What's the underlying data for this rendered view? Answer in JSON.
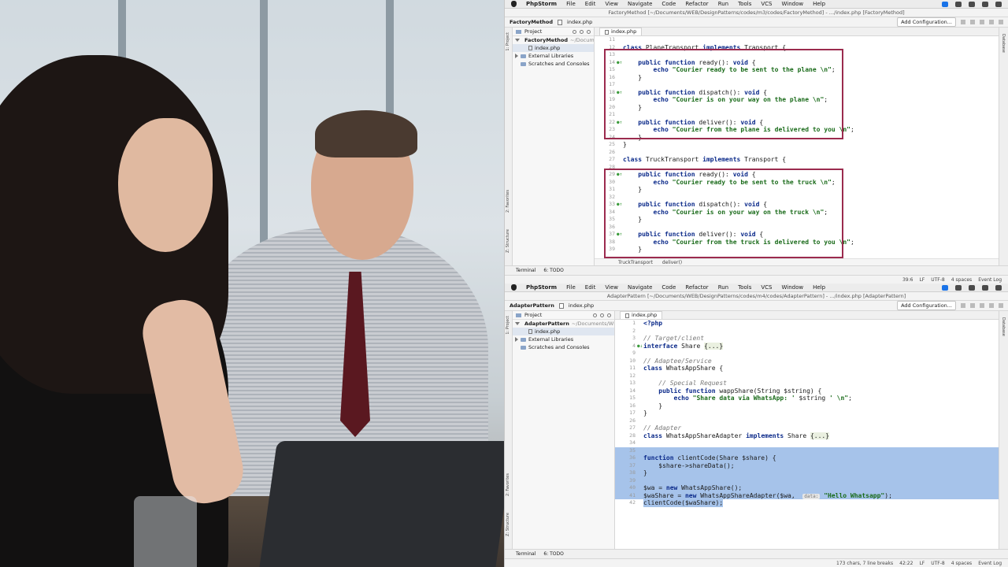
{
  "top": {
    "menubar": {
      "app": "PhpStorm",
      "items": [
        "File",
        "Edit",
        "View",
        "Navigate",
        "Code",
        "Refactor",
        "Run",
        "Tools",
        "VCS",
        "Window",
        "Help"
      ]
    },
    "title": "FactoryMethod [~/Documents/WEB/DesignPatterns/codes/m3/codes/FactoryMethod] - .../index.php [FactoryMethod]",
    "nav": {
      "project": "FactoryMethod",
      "file": "index.php",
      "add_config": "Add Configuration..."
    },
    "project_pane": {
      "label": "Project",
      "items": [
        {
          "label": "FactoryMethod",
          "path": "~/Documents"
        },
        {
          "label": "index.php"
        },
        {
          "label": "External Libraries"
        },
        {
          "label": "Scratches and Consoles"
        }
      ]
    },
    "tab": "index.php",
    "left_tabs": [
      "1: Project",
      "2: Favorites",
      "Z: Structure"
    ],
    "right_tab": "Database",
    "code": [
      {
        "n": "11",
        "html": ""
      },
      {
        "n": "12",
        "html": "<span class='kw'>class</span> PlaneTransport <span class='kw'>implements</span> Transport {"
      },
      {
        "n": "13",
        "html": ""
      },
      {
        "n": "14",
        "html": "    <span class='kw'>public function</span> ready(): <span class='kw'>void</span> {"
      },
      {
        "n": "15",
        "html": "        <span class='kw'>echo</span> <span class='str'>\"Courier ready to be sent to the plane \\n\"</span>;"
      },
      {
        "n": "16",
        "html": "    }"
      },
      {
        "n": "17",
        "html": ""
      },
      {
        "n": "18",
        "html": "    <span class='kw'>public function</span> dispatch(): <span class='kw'>void</span> {"
      },
      {
        "n": "19",
        "html": "        <span class='kw'>echo</span> <span class='str'>\"Courier is on your way on the plane \\n\"</span>;"
      },
      {
        "n": "20",
        "html": "    }"
      },
      {
        "n": "21",
        "html": ""
      },
      {
        "n": "22",
        "html": "    <span class='kw'>public function</span> deliver(): <span class='kw'>void</span> {"
      },
      {
        "n": "23",
        "html": "        <span class='kw'>echo</span> <span class='str'>\"Courier from the plane is delivered to you \\n\"</span>;"
      },
      {
        "n": "24",
        "html": "    }"
      },
      {
        "n": "25",
        "html": "}"
      },
      {
        "n": "26",
        "html": ""
      },
      {
        "n": "27",
        "html": "<span class='kw'>class</span> TruckTransport <span class='kw'>implements</span> Transport {"
      },
      {
        "n": "28",
        "html": ""
      },
      {
        "n": "29",
        "html": "    <span class='kw'>public function</span> ready(): <span class='kw'>void</span> {"
      },
      {
        "n": "30",
        "html": "        <span class='kw'>echo</span> <span class='str'>\"Courier ready to be sent to the truck \\n\"</span>;"
      },
      {
        "n": "31",
        "html": "    }"
      },
      {
        "n": "32",
        "html": ""
      },
      {
        "n": "33",
        "html": "    <span class='kw'>public function</span> dispatch(): <span class='kw'>void</span> {"
      },
      {
        "n": "34",
        "html": "        <span class='kw'>echo</span> <span class='str'>\"Courier is on your way on the truck \\n\"</span>;"
      },
      {
        "n": "35",
        "html": "    }"
      },
      {
        "n": "36",
        "html": ""
      },
      {
        "n": "37",
        "html": "    <span class='kw'>public function</span> deliver(): <span class='kw'>void</span> {"
      },
      {
        "n": "38",
        "html": "        <span class='kw'>echo</span> <span class='str'>\"Courier from the truck is delivered to you \\n\"</span>;"
      },
      {
        "n": "39",
        "html": "    }"
      }
    ],
    "markers": {
      "14": "●↑",
      "18": "●↑",
      "22": "●↑",
      "29": "●↑",
      "33": "●↑",
      "37": "●↑"
    },
    "breadcrumb": [
      "TruckTransport",
      "deliver()"
    ],
    "bottom_tools": [
      "Terminal",
      "6: TODO"
    ],
    "status": {
      "pos": "39:6",
      "lf": "LF",
      "enc": "UTF-8",
      "indent": "4 spaces",
      "event_log": "Event Log"
    }
  },
  "bottom": {
    "menubar": {
      "app": "PhpStorm",
      "items": [
        "File",
        "Edit",
        "View",
        "Navigate",
        "Code",
        "Refactor",
        "Run",
        "Tools",
        "VCS",
        "Window",
        "Help"
      ]
    },
    "title": "AdapterPattern [~/Documents/WEB/DesignPatterns/codes/m4/codes/AdapterPattern] - .../index.php [AdapterPattern]",
    "nav": {
      "project": "AdapterPattern",
      "file": "index.php",
      "add_config": "Add Configuration..."
    },
    "project_pane": {
      "label": "Project",
      "items": [
        {
          "label": "AdapterPattern",
          "path": "~/Documents/WE"
        },
        {
          "label": "index.php"
        },
        {
          "label": "External Libraries"
        },
        {
          "label": "Scratches and Consoles"
        }
      ]
    },
    "tab": "index.php",
    "left_tabs": [
      "1: Project",
      "2: Favorites",
      "Z: Structure"
    ],
    "right_tab": "Database",
    "code": [
      {
        "n": "1",
        "html": "<span class='kw'>&lt;?php</span>"
      },
      {
        "n": "2",
        "html": ""
      },
      {
        "n": "3",
        "html": "<span class='cm'>// Target/client</span>"
      },
      {
        "n": "4",
        "html": "<span class='kw'>interface</span> Share <span class='fold'>{...}</span>"
      },
      {
        "n": "9",
        "html": ""
      },
      {
        "n": "10",
        "html": "<span class='cm'>// Adaptee/Service</span>"
      },
      {
        "n": "11",
        "html": "<span class='kw'>class</span> WhatsAppShare {"
      },
      {
        "n": "12",
        "html": ""
      },
      {
        "n": "13",
        "html": "    <span class='cm'>// Special Request</span>"
      },
      {
        "n": "14",
        "html": "    <span class='kw'>public function</span> wappShare(String $string) {"
      },
      {
        "n": "15",
        "html": "        <span class='kw'>echo</span> <span class='str'>\"Share data via WhatsApp: '</span> $string <span class='str'>' \\n\"</span>;"
      },
      {
        "n": "16",
        "html": "    }"
      },
      {
        "n": "17",
        "html": "}"
      },
      {
        "n": "26",
        "html": ""
      },
      {
        "n": "27",
        "html": "<span class='cm'>// Adapter</span>"
      },
      {
        "n": "28",
        "html": "<span class='kw'>class</span> WhatsAppShareAdapter <span class='kw'>implements</span> Share <span class='fold'>{...}</span>"
      },
      {
        "n": "34",
        "html": ""
      },
      {
        "n": "35",
        "html": "",
        "sel": true
      },
      {
        "n": "36",
        "html": "<span class='kw'>function</span> clientCode(Share $share) {",
        "sel": true
      },
      {
        "n": "37",
        "html": "    $share->shareData();",
        "sel": true
      },
      {
        "n": "38",
        "html": "}",
        "sel": true
      },
      {
        "n": "39",
        "html": "",
        "sel": true
      },
      {
        "n": "40",
        "html": "$wa = <span class='kw'>new</span> WhatsAppShare();",
        "sel": true
      },
      {
        "n": "41",
        "html": "$waShare = <span class='kw'>new</span> WhatsAppShareAdapter($wa,  <span class='inline-hint'>data:</span> <span class='str'>\"Hello Whatsapp\"</span>);",
        "sel": true
      },
      {
        "n": "42",
        "html": "clientCode($waShare);",
        "sel": "partial"
      }
    ],
    "markers": {
      "4": "●↓"
    },
    "bottom_tools": [
      "Terminal",
      "6: TODO"
    ],
    "status": {
      "chars": "173 chars, 7 line breaks",
      "pos": "42:22",
      "lf": "LF",
      "enc": "UTF-8",
      "indent": "4 spaces",
      "event_log": "Event Log"
    }
  }
}
